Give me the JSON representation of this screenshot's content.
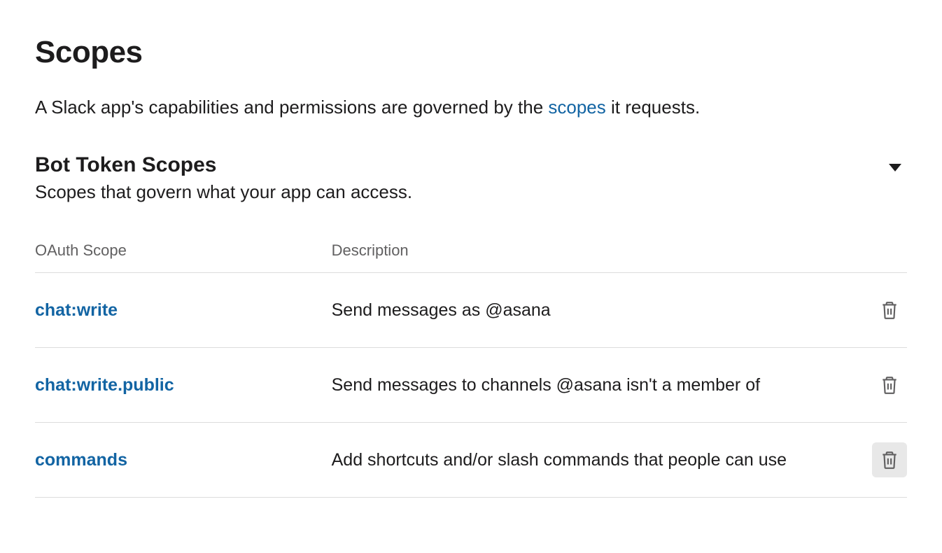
{
  "header": {
    "title": "Scopes",
    "intro_prefix": "A Slack app's capabilities and permissions are governed by the ",
    "intro_link": "scopes",
    "intro_suffix": " it requests."
  },
  "section": {
    "title": "Bot Token Scopes",
    "subtitle": "Scopes that govern what your app can access."
  },
  "table": {
    "headers": {
      "scope": "OAuth Scope",
      "description": "Description"
    },
    "rows": [
      {
        "scope": "chat:write",
        "description": "Send messages as @asana"
      },
      {
        "scope": "chat:write.public",
        "description": "Send messages to channels @asana isn't a member of"
      },
      {
        "scope": "commands",
        "description": "Add shortcuts and/or slash commands that people can use"
      }
    ]
  }
}
